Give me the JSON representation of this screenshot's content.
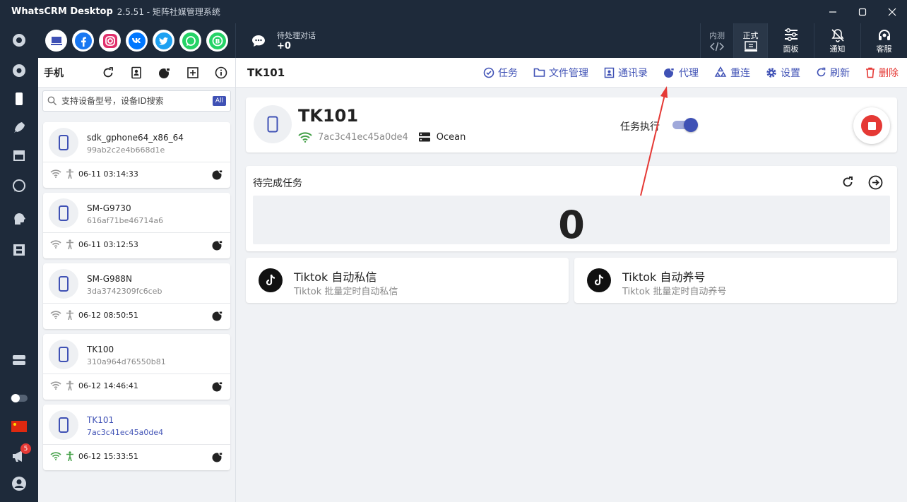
{
  "window": {
    "app_name": "WhatsCRM Desktop",
    "subtitle": "2.5.51 - 矩阵社媒管理系统"
  },
  "rail": {
    "badge_count": "5"
  },
  "topbar": {
    "pending_label": "待处理对话",
    "pending_count": "+0",
    "env_test": "内测",
    "env_prod": "正式",
    "panel": "面板",
    "notify": "通知",
    "service": "客服"
  },
  "phones": {
    "title": "手机",
    "search_placeholder": "支持设备型号，设备ID搜索",
    "search_badge": "All",
    "devices": [
      {
        "name": "sdk_gphone64_x86_64",
        "id": "99ab2c2e4b668d1e",
        "time": "06-11 03:14:33"
      },
      {
        "name": "SM-G9730",
        "id": "616af71be46714a6",
        "time": "06-11 03:12:53"
      },
      {
        "name": "SM-G988N",
        "id": "3da3742309fc6ceb",
        "time": "06-12 08:50:51"
      },
      {
        "name": "TK100",
        "id": "310a964d76550b81",
        "time": "06-12 14:46:41"
      },
      {
        "name": "TK101",
        "id": "7ac3c41ec45a0de4",
        "time": "06-12 15:33:51"
      }
    ]
  },
  "main": {
    "title": "TK101",
    "actions": {
      "task": "任务",
      "files": "文件管理",
      "contacts": "通讯录",
      "proxy": "代理",
      "reconnect": "重连",
      "settings": "设置",
      "refresh": "刷新",
      "delete": "删除"
    },
    "device": {
      "name": "TK101",
      "id": "7ac3c41ec45a0de4",
      "server": "Ocean",
      "exec_label": "任务执行"
    },
    "pending_tasks": {
      "label": "待完成任务",
      "count": "0"
    },
    "tasks": [
      {
        "name": "Tiktok 自动私信",
        "desc": "Tiktok 批量定时自动私信"
      },
      {
        "name": "Tiktok 自动养号",
        "desc": "Tiktok 批量定时自动养号"
      }
    ]
  },
  "colors": {
    "accent": "#3f51b5",
    "danger": "#e53935",
    "dark": "#1e2a3a",
    "online": "#43a047"
  }
}
